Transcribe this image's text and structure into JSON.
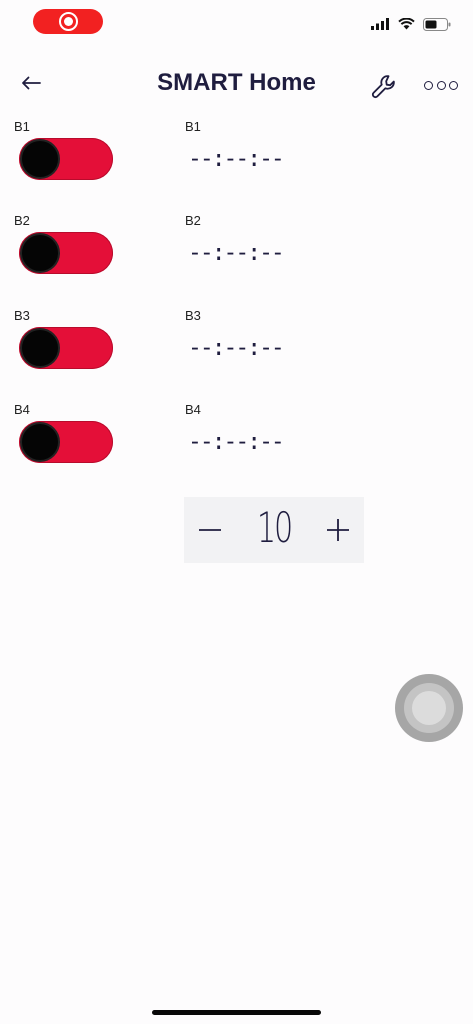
{
  "header": {
    "title": "SMART Home"
  },
  "rows": [
    {
      "switch_label": "B1",
      "timer_label": "B1",
      "timer_value": "--:--:--",
      "switch_on": false
    },
    {
      "switch_label": "B2",
      "timer_label": "B2",
      "timer_value": "--:--:--",
      "switch_on": false
    },
    {
      "switch_label": "B3",
      "timer_label": "B3",
      "timer_value": "--:--:--",
      "switch_on": false
    },
    {
      "switch_label": "B4",
      "timer_label": "B4",
      "timer_value": "--:--:--",
      "switch_on": false
    }
  ],
  "stepper": {
    "value": "10",
    "minus_glyph": "—",
    "plus_glyph": "+"
  },
  "colors": {
    "switch_off": "#e40f38",
    "title": "#1f1d3f",
    "recording": "#f22121"
  },
  "icons": [
    "record-icon",
    "cellular-signal-icon",
    "wifi-icon",
    "battery-icon",
    "back-arrow-icon",
    "wrench-icon",
    "more-icon",
    "assistive-touch-icon"
  ]
}
